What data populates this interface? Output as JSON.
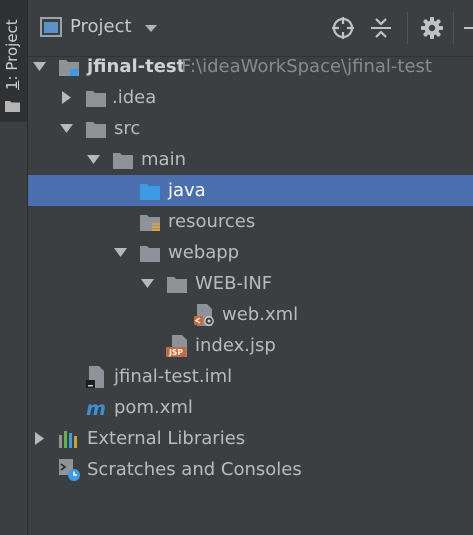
{
  "strip": {
    "tab_number": "1",
    "tab_label": ": Project"
  },
  "header": {
    "title": "Project"
  },
  "tree": {
    "root_name": "jfinal-test",
    "root_path": "F:\\ideaWorkSpace\\jfinal-test",
    "idea": ".idea",
    "src": "src",
    "main": "main",
    "java": "java",
    "resources": "resources",
    "webapp": "webapp",
    "webinf": "WEB-INF",
    "webxml": "web.xml",
    "indexjsp": "index.jsp",
    "iml": "jfinal-test.iml",
    "pom": "pom.xml",
    "external": "External Libraries",
    "scratches": "Scratches and Consoles",
    "jsp_badge": "JSP"
  },
  "colors": {
    "selection": "#4b6eaf",
    "folder": "#8d9399",
    "java_folder": "#3d9be6"
  },
  "icons": [
    "project-view-icon",
    "caret-down-icon",
    "locate-icon",
    "collapse-all-icon",
    "gear-icon",
    "folder-icon",
    "xml-file-icon",
    "jsp-file-icon",
    "iml-file-icon",
    "maven-icon",
    "libraries-icon",
    "scratches-icon"
  ]
}
